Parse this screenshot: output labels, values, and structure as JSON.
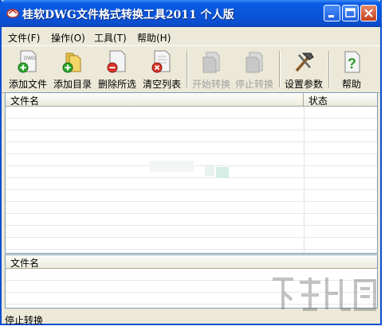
{
  "window": {
    "title": "桂软DWG文件格式转换工具2011 个人版",
    "icon": "dwg-app-icon"
  },
  "title_buttons": {
    "minimize": "minimize-icon",
    "maximize": "maximize-icon",
    "close": "close-icon"
  },
  "menu": [
    {
      "label": "文件(F)"
    },
    {
      "label": "操作(O)"
    },
    {
      "label": "工具(T)"
    },
    {
      "label": "帮助(H)"
    }
  ],
  "toolbar": {
    "add_file": "添加文件",
    "add_dir": "添加目录",
    "remove_selected": "删除所选",
    "clear_list": "清空列表",
    "start": "开始转换",
    "stop": "停止转换",
    "settings": "设置参数",
    "help": "帮助"
  },
  "list": {
    "col_filename": "文件名",
    "col_status": "状态"
  },
  "lower_list": {
    "col_filename": "文件名"
  },
  "status": {
    "text": "停止转换"
  },
  "colors": {
    "title_blue": "#0a55da",
    "window_bg": "#ece9d8",
    "close_red": "#c4401e"
  }
}
